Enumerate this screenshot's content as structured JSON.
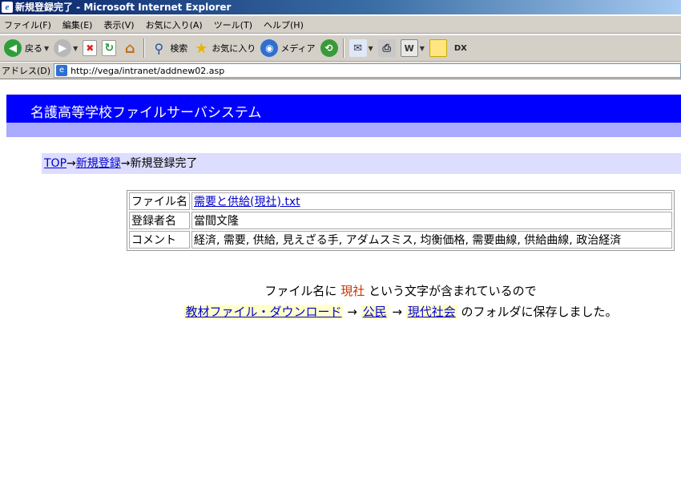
{
  "window": {
    "title": "新規登録完了 - Microsoft Internet Explorer"
  },
  "menu": {
    "items": [
      "ファイル(F)",
      "編集(E)",
      "表示(V)",
      "お気に入り(A)",
      "ツール(T)",
      "ヘルプ(H)"
    ]
  },
  "toolbar": {
    "back_label": "戻る",
    "search_label": "検索",
    "favorites_label": "お気に入り",
    "media_label": "メディア"
  },
  "address": {
    "label": "アドレス(D)",
    "url": "http://vega/intranet/addnew02.asp"
  },
  "page": {
    "banner_title": "名護高等学校ファイルサーバシステム",
    "breadcrumb": {
      "top": "TOP",
      "arrow": "→",
      "new_register": "新規登録",
      "current": "新規登録完了"
    },
    "info_table": {
      "file_name_label": "ファイル名",
      "file_name_value": "需要と供給(現社).txt",
      "registrant_label": "登録者名",
      "registrant_value": "當間文隆",
      "comment_label": "コメント",
      "comment_value": "経済, 需要, 供給, 見えざる手, アダムスミス, 均衡価格, 需要曲線, 供給曲線, 政治経済"
    },
    "notice": {
      "line1_prefix": "ファイル名に",
      "keyword": "現社",
      "line1_suffix": "という文字が含まれているので",
      "folder1": "教材ファイル・ダウンロード",
      "arrow": "→",
      "folder2": "公民",
      "folder3": "現代社会",
      "line2_suffix": "のフォルダに保存しました。"
    }
  },
  "colors": {
    "banner": "#0000ff",
    "banner_band": "#aaaaff",
    "breadcrumb_bg": "#ddddff",
    "link": "#0000cc",
    "keyword": "#cc3300"
  }
}
